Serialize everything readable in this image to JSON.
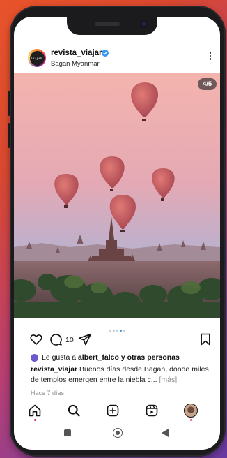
{
  "post": {
    "username": "revista_viajar",
    "location": "Bagan Myanmar",
    "avatar_text": "VIAJAR",
    "counter": "4/5",
    "comments_count": "10",
    "likes_prefix": "Le gusta a ",
    "liked_by": "albert_falco",
    "likes_suffix": " y otras personas",
    "caption_user": "revista_viajar",
    "caption_text": " Buenos días desde Bagan, donde miles de templos emergen entre la niebla c...",
    "caption_more": " [más]",
    "time_ago": "Hace 7 días"
  },
  "carousel": {
    "total": 5,
    "active": 4
  },
  "icons": {
    "header": [
      "verified-icon",
      "more-options-icon"
    ],
    "actions": [
      "heart-icon",
      "comment-icon",
      "share-icon",
      "bookmark-icon"
    ],
    "nav": [
      "home-icon",
      "search-icon",
      "add-post-icon",
      "reels-icon",
      "profile-icon"
    ],
    "system": [
      "recent-apps-icon",
      "home-button-icon",
      "back-icon"
    ]
  },
  "colors": {
    "verified": "#3897f0",
    "notification_dot": "#e0245e",
    "balloon": "#c25a5e",
    "sky_top": "#f2a8a6",
    "sky_bottom": "#a0b0cf"
  }
}
